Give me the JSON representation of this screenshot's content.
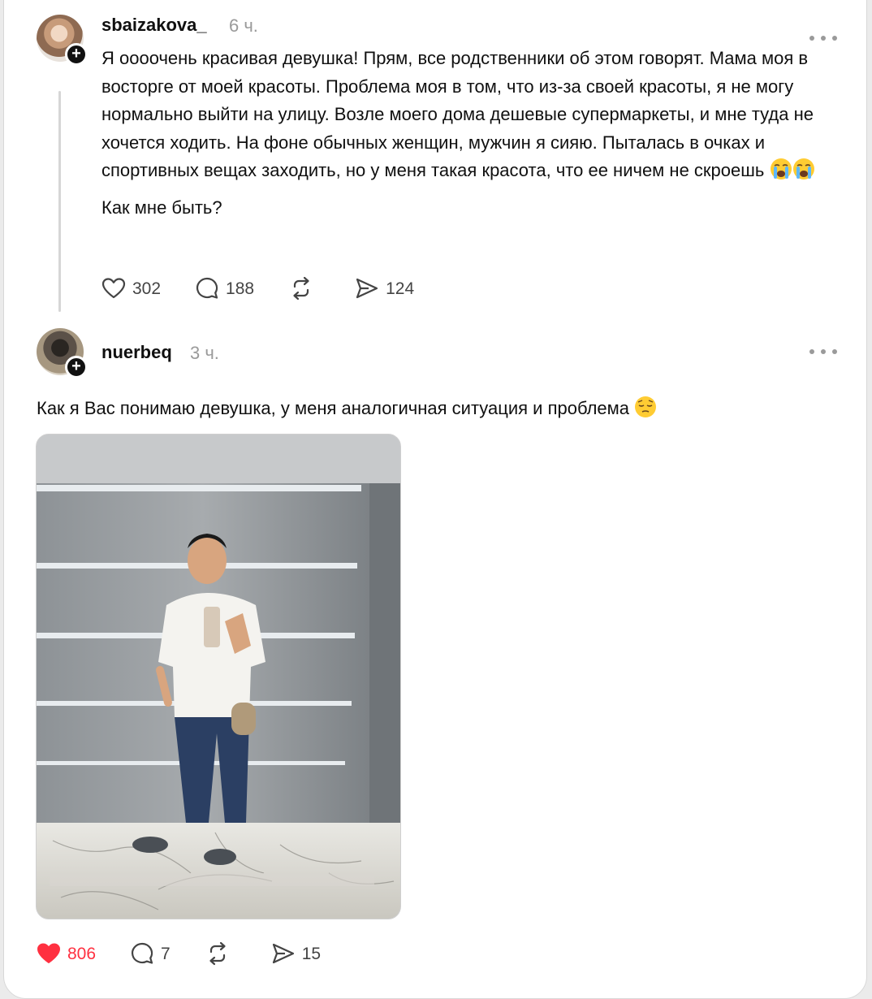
{
  "post": {
    "username": "sbaizakova_",
    "time": "6 ч.",
    "paragraph1": "Я оооочень красивая девушка! Прям, все родственники об этом говорят. Мама моя в восторге от моей красоты. Проблема моя в том, что из-за своей красоты, я не могу нормально выйти на улицу. Возле моего дома дешевые супермаркеты, и мне туда не хочется ходить. На фоне обычных женщин, мужчин я сияю. Пыталась в очках и спортивных вещах заходить, но у меня такая красота, что ее ничем не скроешь",
    "paragraph1_emoji": [
      "loudly-crying-face",
      "loudly-crying-face"
    ],
    "paragraph2": "Как мне быть?",
    "likes": "302",
    "comments": "188",
    "shares": "124"
  },
  "reply": {
    "username": "nuerbeq",
    "time": "3 ч.",
    "text": "Как я Вас понимаю девушка, у меня аналогичная ситуация и проблема",
    "text_emoji": "pensive-face",
    "photo_alt": "mirror selfie photo",
    "likes": "806",
    "comments": "7",
    "shares": "15",
    "liked": true
  },
  "colors": {
    "like_active": "#ff3040",
    "text_primary": "#101010",
    "text_secondary": "#9a9a9a",
    "icon": "#444444"
  }
}
